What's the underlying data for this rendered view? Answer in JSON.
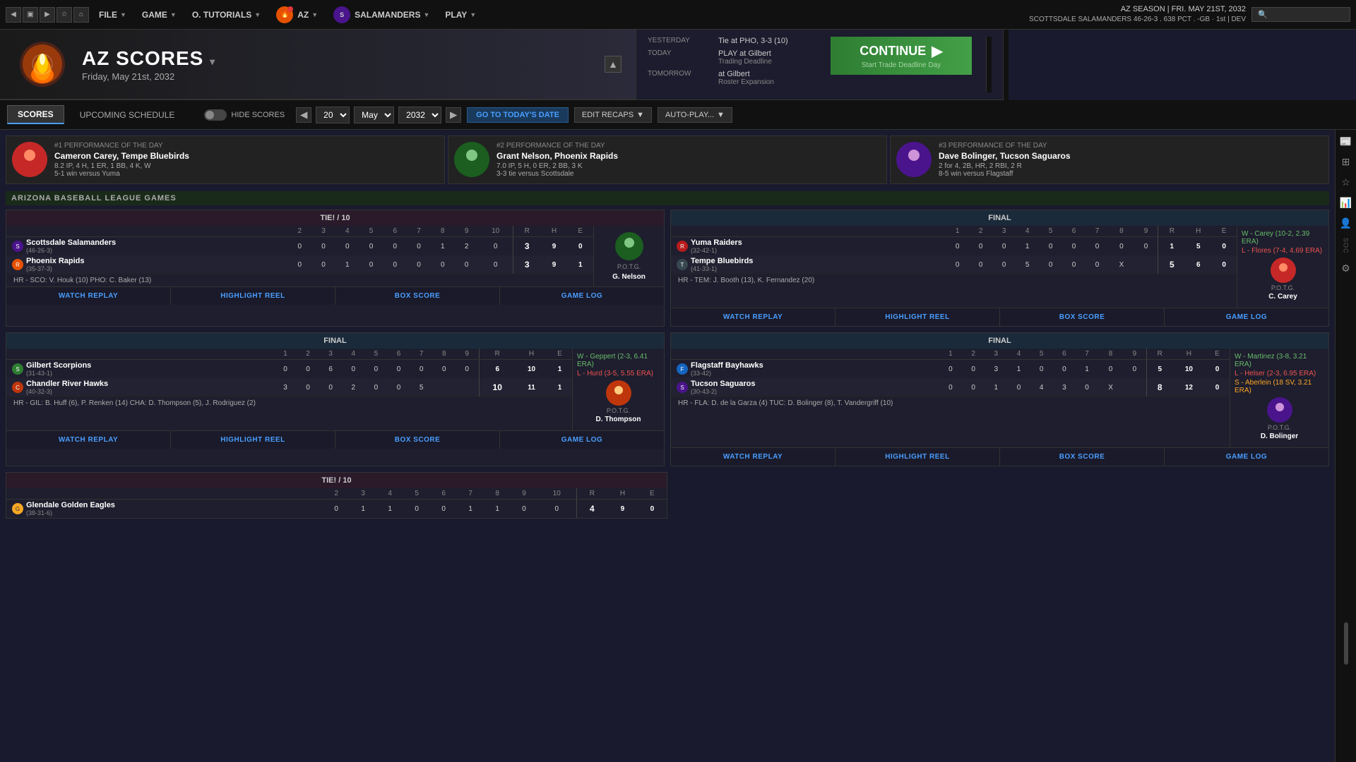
{
  "app": {
    "title": "AZ Scores"
  },
  "topnav": {
    "file_label": "FILE",
    "game_label": "GAME",
    "tutorials_label": "O. TUTORIALS",
    "az_label": "AZ",
    "team_label": "SALAMANDERS",
    "play_label": "PLAY",
    "season_info_line1": "AZ SEASON  |  FRI. MAY 21ST, 2032",
    "season_info_line2": "SCOTTSDALE SALAMANDERS  46-26-3 . 638 PCT . -GB · 1st | DEV",
    "search_placeholder": "🔍"
  },
  "header": {
    "title": "AZ SCORES",
    "date": "Friday, May 21st, 2032"
  },
  "schedule": {
    "yesterday_label": "YESTERDAY",
    "yesterday_val": "Tie at PHO, 3-3 (10)",
    "today_label": "TODAY",
    "today_val": "PLAY at Gilbert",
    "today_sub": "Trading Deadline",
    "tomorrow_label": "TOMORROW",
    "tomorrow_val": "at Gilbert",
    "tomorrow_sub": "Roster Expansion",
    "continue_label": "CONTINUE",
    "continue_sub": "Start Trade Deadline Day"
  },
  "scores_bar": {
    "scores_tab": "SCORES",
    "upcoming_tab": "UPCOMING SCHEDULE",
    "hide_scores": "HIDE SCORES",
    "day_val": "20",
    "month_val": "May",
    "year_val": "2032",
    "today_btn": "GO TO TODAY'S DATE",
    "edit_recaps": "EDIT RECAPS",
    "autoplay": "AUTO-PLAY..."
  },
  "performances": [
    {
      "rank": "#1 PERFORMANCE OF THE DAY",
      "name": "Cameron Carey, Tempe Bluebirds",
      "stats_line1": "8.2 IP, 4 H, 1 ER, 1 BB, 4 K, W",
      "stats_line2": "5-1 win versus Yuma",
      "emoji": "⚾"
    },
    {
      "rank": "#2 PERFORMANCE OF THE DAY",
      "name": "Grant Nelson, Phoenix Rapids",
      "stats_line1": "7.0 IP, 5 H, 0 ER, 2 BB, 3 K",
      "stats_line2": "3-3 tie versus Scottsdale",
      "emoji": "⚾"
    },
    {
      "rank": "#3 PERFORMANCE OF THE DAY",
      "name": "Dave Bolinger, Tucson Saguaros",
      "stats_line1": "2 for 4, 2B, HR, 2 RBI, 2 R",
      "stats_line2": "8-5 win versus Flagstaff",
      "emoji": "⚾"
    }
  ],
  "section_header": "ARIZONA BASEBALL LEAGUE GAMES",
  "games": [
    {
      "id": "g1",
      "status": "TIE! / 10",
      "status_type": "tie",
      "teams": [
        {
          "name": "Scottsdale Salamanders",
          "record": "(46-26-3)",
          "innings": [
            "",
            "0",
            "0",
            "0",
            "0",
            "0",
            "0",
            "1",
            "2",
            "0"
          ],
          "r": "3",
          "h": "9",
          "e": "0"
        },
        {
          "name": "Phoenix Rapids",
          "record": "(35-37-3)",
          "innings": [
            "",
            "0",
            "0",
            "1",
            "0",
            "0",
            "0",
            "0",
            "0",
            "0"
          ],
          "r": "3",
          "h": "9",
          "e": "1"
        }
      ],
      "innings_count": 10,
      "hr_notes": "HR - SCO: V. Houk (10)  PHO: C. Baker (13)",
      "potg_label": "P.O.T.G.",
      "potg_name": "G. Nelson",
      "pitcher_win": null,
      "pitcher_loss": null,
      "actions": [
        "WATCH REPLAY",
        "HIGHLIGHT REEL",
        "BOX SCORE",
        "GAME LOG"
      ]
    },
    {
      "id": "g2",
      "status": "FINAL",
      "status_type": "final",
      "teams": [
        {
          "name": "Yuma Raiders",
          "record": "(32-42-1)",
          "innings": [
            "",
            "0",
            "0",
            "0",
            "1",
            "0",
            "0",
            "0",
            "0",
            "0"
          ],
          "r": "1",
          "h": "5",
          "e": "0"
        },
        {
          "name": "Tempe Bluebirds",
          "record": "(41-33-1)",
          "innings": [
            "",
            "0",
            "0",
            "0",
            "5",
            "0",
            "0",
            "0",
            "X",
            ""
          ],
          "r": "5",
          "h": "6",
          "e": "0"
        }
      ],
      "innings_count": 9,
      "hr_notes": "HR - TEM: J. Booth (13), K. Fernandez (20)",
      "potg_label": "P.O.T.G.",
      "potg_name": "C. Carey",
      "pitcher_win": "W - Carey (10-2, 2.39 ERA)",
      "pitcher_loss": "L - Flores (7-4, 4.69 ERA)",
      "pitcher_save": null,
      "actions": [
        "WATCH REPLAY",
        "HIGHLIGHT REEL",
        "BOX SCORE",
        "GAME LOG"
      ]
    },
    {
      "id": "g3",
      "status": "FINAL",
      "status_type": "final",
      "teams": [
        {
          "name": "Gilbert Scorpions",
          "record": "(31-43-1)",
          "innings": [
            "",
            "0",
            "0",
            "6",
            "0",
            "0",
            "0",
            "0",
            "0",
            "0"
          ],
          "r": "6",
          "h": "10",
          "e": "1"
        },
        {
          "name": "Chandler River Hawks",
          "record": "(40-32-3)",
          "innings": [
            "",
            "3",
            "0",
            "0",
            "2",
            "0",
            "0",
            "5",
            "",
            ""
          ],
          "r": "10",
          "h": "11",
          "e": "1"
        }
      ],
      "innings_count": 9,
      "hr_notes": "HR - GIL: B. Huff (6), P. Renken (14)  CHA: D. Thompson (5), J. Rodriguez (2)",
      "potg_label": "P.O.T.G.",
      "potg_name": "D. Thompson",
      "pitcher_win": "W - Geppert (2-3, 6.41 ERA)",
      "pitcher_loss": "L - Hurd (3-5, 5.55 ERA)",
      "pitcher_save": null,
      "actions": [
        "WATCH REPLAY",
        "HIGHLIGHT REEL",
        "BOX SCORE",
        "GAME LOG"
      ]
    },
    {
      "id": "g4",
      "status": "FINAL",
      "status_type": "final",
      "teams": [
        {
          "name": "Flagstaff Bayhawks",
          "record": "(33-42)",
          "innings": [
            "",
            "0",
            "0",
            "3",
            "1",
            "0",
            "0",
            "1",
            "0",
            "0"
          ],
          "r": "5",
          "h": "10",
          "e": "0"
        },
        {
          "name": "Tucson Saguaros",
          "record": "(30-43-2)",
          "innings": [
            "",
            "0",
            "0",
            "1",
            "0",
            "4",
            "3",
            "0",
            "X",
            ""
          ],
          "r": "8",
          "h": "12",
          "e": "0"
        }
      ],
      "innings_count": 9,
      "hr_notes": "HR - FLA: D. de la Garza (4)  TUC: D. Bolinger (8), T. Vandergriff (10)",
      "potg_label": "P.O.T.G.",
      "potg_name": "D. Bolinger",
      "pitcher_win": "W - Martinez (3-8, 3.21 ERA)",
      "pitcher_loss": "L - Helser (2-3, 6.95 ERA)",
      "pitcher_save": "S - Aberlein (18 SV, 3.21 ERA)",
      "actions": [
        "WATCH REPLAY",
        "HIGHLIGHT REEL",
        "BOX SCORE",
        "GAME LOG"
      ]
    }
  ],
  "game5": {
    "id": "g5",
    "status": "TIE! / 10",
    "status_type": "tie",
    "teams": [
      {
        "name": "Glendale Golden Eagles",
        "record": "(38-31-6)",
        "innings": [
          "",
          "0",
          "1",
          "1",
          "0",
          "0",
          "1",
          "1",
          "0",
          "0"
        ],
        "r": "4",
        "h": "9",
        "e": "0"
      }
    ]
  },
  "right_sidebar": {
    "icons": [
      "◈",
      "⊞",
      "☰",
      "📊",
      "⚙",
      "≡"
    ]
  }
}
